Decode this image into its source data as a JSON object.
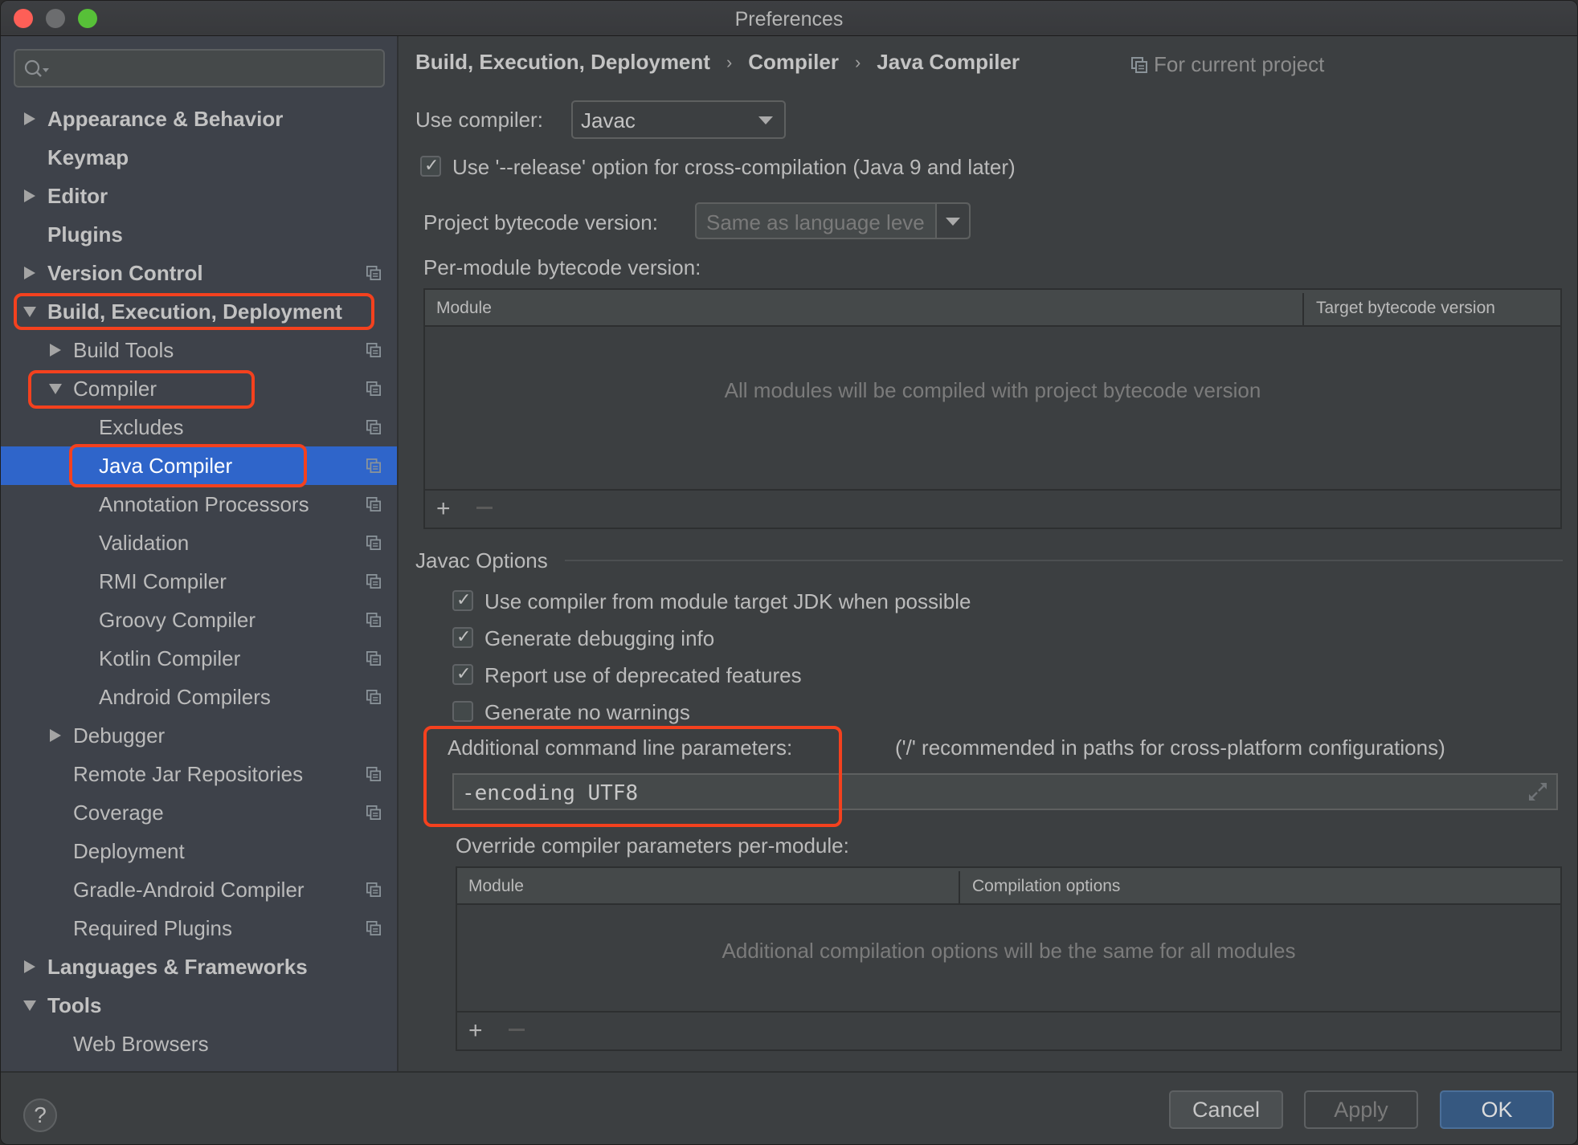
{
  "window": {
    "title": "Preferences"
  },
  "sidebar": {
    "search_placeholder": "",
    "items": [
      {
        "label": "Appearance & Behavior",
        "level": 0,
        "bold": true,
        "arrow": "right",
        "project_icon": false
      },
      {
        "label": "Keymap",
        "level": 0,
        "bold": true,
        "arrow": null,
        "project_icon": false
      },
      {
        "label": "Editor",
        "level": 0,
        "bold": true,
        "arrow": "right",
        "project_icon": false
      },
      {
        "label": "Plugins",
        "level": 0,
        "bold": true,
        "arrow": null,
        "project_icon": false
      },
      {
        "label": "Version Control",
        "level": 0,
        "bold": true,
        "arrow": "right",
        "project_icon": true
      },
      {
        "label": "Build, Execution, Deployment",
        "level": 0,
        "bold": true,
        "arrow": "down",
        "project_icon": false,
        "highlighted": true
      },
      {
        "label": "Build Tools",
        "level": 1,
        "bold": false,
        "arrow": "right",
        "project_icon": true
      },
      {
        "label": "Compiler",
        "level": 1,
        "bold": false,
        "arrow": "down",
        "project_icon": true,
        "highlighted": true
      },
      {
        "label": "Excludes",
        "level": 2,
        "bold": false,
        "arrow": null,
        "project_icon": true
      },
      {
        "label": "Java Compiler",
        "level": 2,
        "bold": false,
        "arrow": null,
        "project_icon": true,
        "selected": true,
        "highlighted": true
      },
      {
        "label": "Annotation Processors",
        "level": 2,
        "bold": false,
        "arrow": null,
        "project_icon": true
      },
      {
        "label": "Validation",
        "level": 2,
        "bold": false,
        "arrow": null,
        "project_icon": true
      },
      {
        "label": "RMI Compiler",
        "level": 2,
        "bold": false,
        "arrow": null,
        "project_icon": true
      },
      {
        "label": "Groovy Compiler",
        "level": 2,
        "bold": false,
        "arrow": null,
        "project_icon": true
      },
      {
        "label": "Kotlin Compiler",
        "level": 2,
        "bold": false,
        "arrow": null,
        "project_icon": true
      },
      {
        "label": "Android Compilers",
        "level": 2,
        "bold": false,
        "arrow": null,
        "project_icon": true
      },
      {
        "label": "Debugger",
        "level": 1,
        "bold": false,
        "arrow": "right",
        "project_icon": false
      },
      {
        "label": "Remote Jar Repositories",
        "level": 1,
        "bold": false,
        "arrow": null,
        "project_icon": true
      },
      {
        "label": "Coverage",
        "level": 1,
        "bold": false,
        "arrow": null,
        "project_icon": true
      },
      {
        "label": "Deployment",
        "level": 1,
        "bold": false,
        "arrow": null,
        "project_icon": false
      },
      {
        "label": "Gradle-Android Compiler",
        "level": 1,
        "bold": false,
        "arrow": null,
        "project_icon": true
      },
      {
        "label": "Required Plugins",
        "level": 1,
        "bold": false,
        "arrow": null,
        "project_icon": true
      },
      {
        "label": "Languages & Frameworks",
        "level": 0,
        "bold": true,
        "arrow": "right",
        "project_icon": false
      },
      {
        "label": "Tools",
        "level": 0,
        "bold": true,
        "arrow": "down",
        "project_icon": false
      },
      {
        "label": "Web Browsers",
        "level": 1,
        "bold": false,
        "arrow": null,
        "project_icon": false
      }
    ]
  },
  "breadcrumb": {
    "items": [
      "Build, Execution, Deployment",
      "Compiler",
      "Java Compiler"
    ],
    "separator": "›",
    "scope_label": "For current project"
  },
  "compiler": {
    "use_compiler_label": "Use compiler:",
    "use_compiler_value": "Javac",
    "release_option_label": "Use '--release' option for cross-compilation (Java 9 and later)",
    "release_option_checked": true,
    "project_bytecode_label": "Project bytecode version:",
    "project_bytecode_value": "Same as language leve",
    "per_module_label": "Per-module bytecode version:",
    "per_module_table": {
      "columns": [
        "Module",
        "Target bytecode version"
      ],
      "rows": [],
      "empty_text": "All modules will be compiled with project bytecode version",
      "add_label": "+",
      "remove_label": "−"
    }
  },
  "javac": {
    "section_title": "Javac Options",
    "options": [
      {
        "label": "Use compiler from module target JDK when possible",
        "checked": true
      },
      {
        "label": "Generate debugging info",
        "checked": true
      },
      {
        "label": "Report use of deprecated features",
        "checked": true
      },
      {
        "label": "Generate no warnings",
        "checked": false
      }
    ],
    "additional_params_label": "Additional command line parameters:",
    "additional_params_hint": "('/' recommended in paths for cross-platform configurations)",
    "additional_params_value": "-encoding UTF8",
    "override_label": "Override compiler parameters per-module:",
    "override_table": {
      "columns": [
        "Module",
        "Compilation options"
      ],
      "rows": [],
      "empty_text": "Additional compilation options will be the same for all modules",
      "add_label": "+",
      "remove_label": "−"
    }
  },
  "footer": {
    "help_label": "?",
    "cancel_label": "Cancel",
    "apply_label": "Apply",
    "ok_label": "OK"
  },
  "colors": {
    "selection": "#2f65ca",
    "annotation_highlight": "#f4411e",
    "ok_button": "#365880"
  }
}
